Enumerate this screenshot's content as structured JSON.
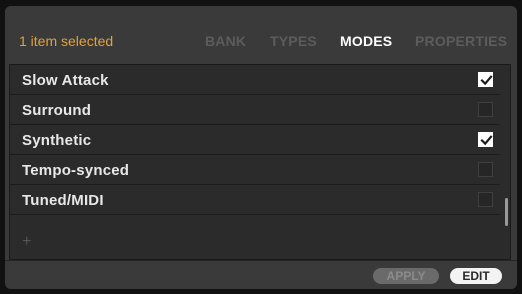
{
  "header": {
    "status": "1 item selected",
    "tabs": [
      "BANK",
      "TYPES",
      "MODES",
      "PROPERTIES"
    ],
    "active_tab": "MODES"
  },
  "list": {
    "items": [
      {
        "label": "Slow Attack",
        "checked": true
      },
      {
        "label": "Surround",
        "checked": false
      },
      {
        "label": "Synthetic",
        "checked": true
      },
      {
        "label": "Tempo-synced",
        "checked": false
      },
      {
        "label": "Tuned/MIDI",
        "checked": false
      }
    ],
    "add_icon": "+"
  },
  "footer": {
    "apply_label": "APPLY",
    "edit_label": "EDIT"
  },
  "colors": {
    "status": "#e1a23a",
    "active_tab": "#ffffff",
    "inactive_tab": "#5c5c5c"
  }
}
